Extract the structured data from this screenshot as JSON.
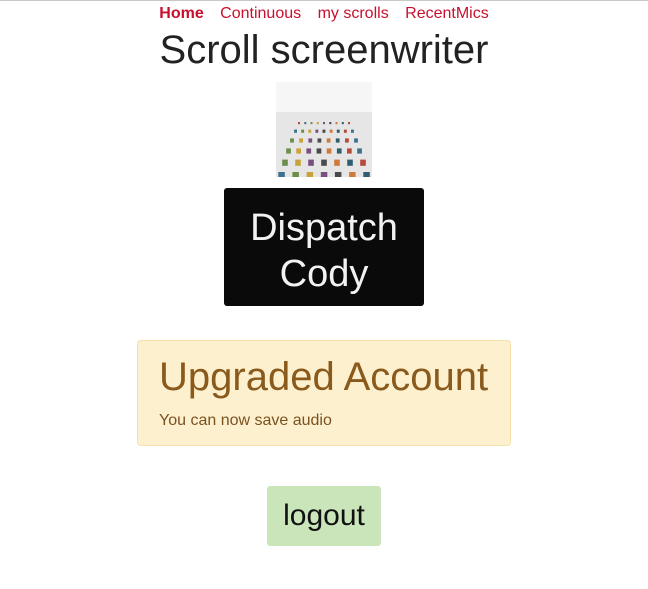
{
  "nav": {
    "items": [
      {
        "label": "Home",
        "active": true
      },
      {
        "label": "Continuous",
        "active": false
      },
      {
        "label": "my scrolls",
        "active": false
      },
      {
        "label": "RecentMics",
        "active": false
      }
    ]
  },
  "page": {
    "title": "Scroll screenwriter"
  },
  "dispatch_button": {
    "line1": "Dispatch",
    "line2": "Cody"
  },
  "alert": {
    "heading": "Upgraded Account",
    "message": "You can now save audio"
  },
  "logout_button": {
    "label": "logout"
  },
  "colors": {
    "nav_link": "#c8102e",
    "dispatch_bg": "#0a0a0a",
    "alert_bg": "#fdf0cf",
    "alert_text": "#8a5a1c",
    "logout_bg": "#c9e5b9"
  }
}
